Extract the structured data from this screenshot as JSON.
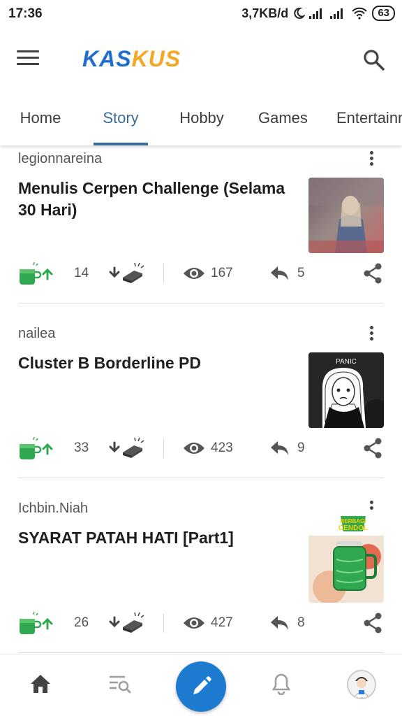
{
  "status_bar": {
    "time": "17:36",
    "network_speed": "3,7KB/d",
    "battery": "63"
  },
  "app_bar": {
    "logo_part1": "KAS",
    "logo_part2": "KUS"
  },
  "tabs": [
    {
      "label": "Home",
      "active": false
    },
    {
      "label": "Story",
      "active": true
    },
    {
      "label": "Hobby",
      "active": false
    },
    {
      "label": "Games",
      "active": false
    },
    {
      "label": "Entertainn",
      "active": false
    }
  ],
  "posts": [
    {
      "author": "legionnareina",
      "title": "Menulis Cerpen Challenge (Selama 30 Hari)",
      "cendol_count": "14",
      "views": "167",
      "replies": "5"
    },
    {
      "author": "nailea",
      "title": "Cluster B Borderline PD",
      "thumb_text": "PANIC",
      "cendol_count": "33",
      "views": "423",
      "replies": "9"
    },
    {
      "author": "Ichbin.Niah",
      "title": "SYARAT PATAH HATI [Part1]",
      "thumb_text_1": "BERBAGI",
      "thumb_text_2": "CENDOL",
      "cendol_count": "26",
      "views": "427",
      "replies": "8"
    }
  ],
  "colors": {
    "accent": "#3b6c99",
    "brand_blue": "#1e6fd0",
    "brand_orange": "#f5a623",
    "cendol_green": "#2fa84f",
    "fab": "#1e7cd0"
  }
}
